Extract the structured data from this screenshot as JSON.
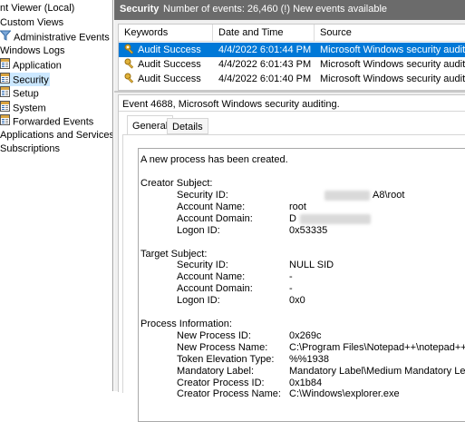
{
  "tree": {
    "items": [
      {
        "label": "nt Viewer (Local)",
        "indent": 0,
        "icon": "none"
      },
      {
        "label": "Custom Views",
        "indent": 0,
        "icon": "none"
      },
      {
        "label": "Administrative Events",
        "indent": 1,
        "icon": "filter-icon"
      },
      {
        "label": "Windows Logs",
        "indent": 0,
        "icon": "none"
      },
      {
        "label": "Application",
        "indent": 1,
        "icon": "log-icon"
      },
      {
        "label": "Security",
        "indent": 1,
        "icon": "log-icon",
        "selected": true
      },
      {
        "label": "Setup",
        "indent": 1,
        "icon": "log-icon"
      },
      {
        "label": "System",
        "indent": 1,
        "icon": "log-icon"
      },
      {
        "label": "Forwarded Events",
        "indent": 1,
        "icon": "log-icon"
      },
      {
        "label": "Applications and Services l",
        "indent": 0,
        "icon": "none"
      },
      {
        "label": "Subscriptions",
        "indent": 0,
        "icon": "none"
      }
    ]
  },
  "header": {
    "title": "Security",
    "info": "Number of events: 26,460 (!) New events available"
  },
  "grid": {
    "columns": [
      "Keywords",
      "Date and Time",
      "Source"
    ],
    "rows": [
      {
        "keyword": "Audit Success",
        "datetime": "4/4/2022 6:01:44 PM",
        "source": "Microsoft Windows security auditing.",
        "selected": true,
        "icon": "search-key-icon"
      },
      {
        "keyword": "Audit Success",
        "datetime": "4/4/2022 6:01:43 PM",
        "source": "Microsoft Windows security auditing.",
        "icon": "key-icon"
      },
      {
        "keyword": "Audit Success",
        "datetime": "4/4/2022 6:01:40 PM",
        "source": "Microsoft Windows security auditing.",
        "icon": "key-icon"
      }
    ]
  },
  "detail": {
    "title": "Event 4688, Microsoft Windows security auditing.",
    "tabs": [
      "General",
      "Details"
    ],
    "active_tab": "General",
    "intro": "A new process has been created.",
    "sections": [
      {
        "heading": "Creator Subject:",
        "fields": [
          {
            "label": "Security ID:",
            "value": "A8\\root",
            "redacted_prefix": true
          },
          {
            "label": "Account Name:",
            "value": "root"
          },
          {
            "label": "Account Domain:",
            "value": "D",
            "redacted_suffix": true
          },
          {
            "label": "Logon ID:",
            "value": "0x53335"
          }
        ]
      },
      {
        "heading": "Target Subject:",
        "fields": [
          {
            "label": "Security ID:",
            "value": "NULL SID"
          },
          {
            "label": "Account Name:",
            "value": "-"
          },
          {
            "label": "Account Domain:",
            "value": "-"
          },
          {
            "label": "Logon ID:",
            "value": "0x0"
          }
        ]
      },
      {
        "heading": "Process Information:",
        "fields": [
          {
            "label": "New Process ID:",
            "value": "0x269c"
          },
          {
            "label": "New Process Name:",
            "value": "C:\\Program Files\\Notepad++\\notepad++.exe"
          },
          {
            "label": "Token Elevation Type:",
            "value": "%%1938"
          },
          {
            "label": "Mandatory Label:",
            "value": "Mandatory Label\\Medium Mandatory Level"
          },
          {
            "label": "Creator Process ID:",
            "value": "0x1b84"
          },
          {
            "label": "Creator Process Name:",
            "value": "C:\\Windows\\explorer.exe"
          }
        ]
      }
    ]
  },
  "colors": {
    "header_bg": "#6b6b6b",
    "selection": "#0078d7",
    "tree_selection": "#cce8ff"
  }
}
